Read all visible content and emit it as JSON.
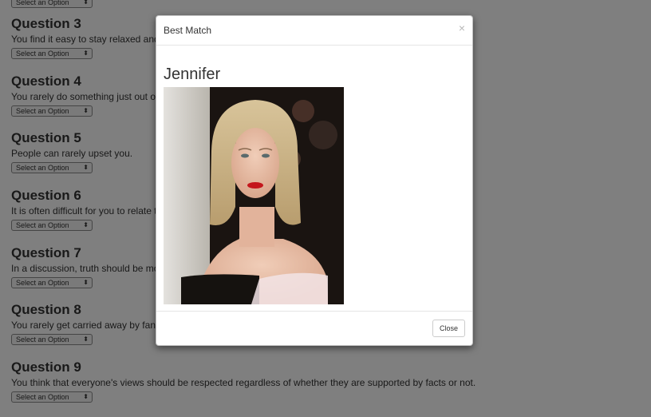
{
  "questions": [
    {
      "title": "Question 3",
      "text": "You find it easy to stay relaxed and focused even when there is some pressure.",
      "select_value": "Select an Option"
    },
    {
      "title": "Question 4",
      "text": "You rarely do something just out of sheer curiosity.",
      "select_value": "Select an Option"
    },
    {
      "title": "Question 5",
      "text": "People can rarely upset you.",
      "select_value": "Select an Option"
    },
    {
      "title": "Question 6",
      "text": "It is often difficult for you to relate to other people's feelings.",
      "select_value": "Select an Option"
    },
    {
      "title": "Question 7",
      "text": "In a discussion, truth should be more important than people's sensitivities.",
      "select_value": "Select an Option"
    },
    {
      "title": "Question 8",
      "text": "You rarely get carried away by fantasies and ideas.",
      "select_value": "Select an Option"
    },
    {
      "title": "Question 9",
      "text": "You think that everyone's views should be respected regardless of whether they are supported by facts or not.",
      "select_value": "Select an Option"
    }
  ],
  "previous_select_value": "Select an Option",
  "modal": {
    "title": "Best Match",
    "close_symbol": "×",
    "match_name": "Jennifer",
    "close_button_label": "Close"
  }
}
